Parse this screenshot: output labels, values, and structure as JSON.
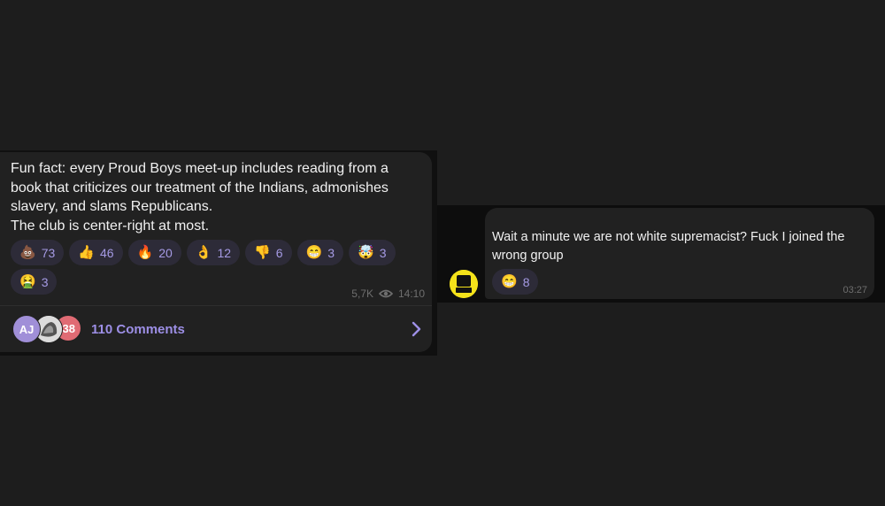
{
  "post_left": {
    "text_lines": [
      "Fun fact: every Proud Boys meet-up includes reading from a",
      "book that criticizes our treatment of the Indians, admonishes",
      "slavery, and slams Republicans.",
      "The club is center-right at most."
    ],
    "reactions": [
      {
        "emoji": "💩",
        "count": "73"
      },
      {
        "emoji": "👍",
        "count": "46"
      },
      {
        "emoji": "🔥",
        "count": "20"
      },
      {
        "emoji": "👌",
        "count": "12"
      },
      {
        "emoji": "👎",
        "count": "6"
      },
      {
        "emoji": "😁",
        "count": "3"
      },
      {
        "emoji": "🤯",
        "count": "3"
      },
      {
        "emoji": "🤮",
        "count": "3"
      }
    ],
    "views": "5,7K",
    "time": "14:10",
    "comments": {
      "avatar_1_initials": "AJ",
      "avatar_3_initials": "38",
      "label": "110 Comments"
    }
  },
  "post_right": {
    "text_lines": [
      "Wait a minute we are not white supremacist? Fuck I joined the",
      "wrong group"
    ],
    "reaction": {
      "emoji": "😁",
      "count": "8"
    },
    "time": "03:27"
  },
  "colors": {
    "background": "#1d1d1d",
    "bubble": "#212121",
    "accent": "#9d8fe6",
    "reaction_bg": "#2d2b38"
  },
  "icons": [
    "eye-icon",
    "chevron-right-icon",
    "pb-logo-avatar"
  ]
}
